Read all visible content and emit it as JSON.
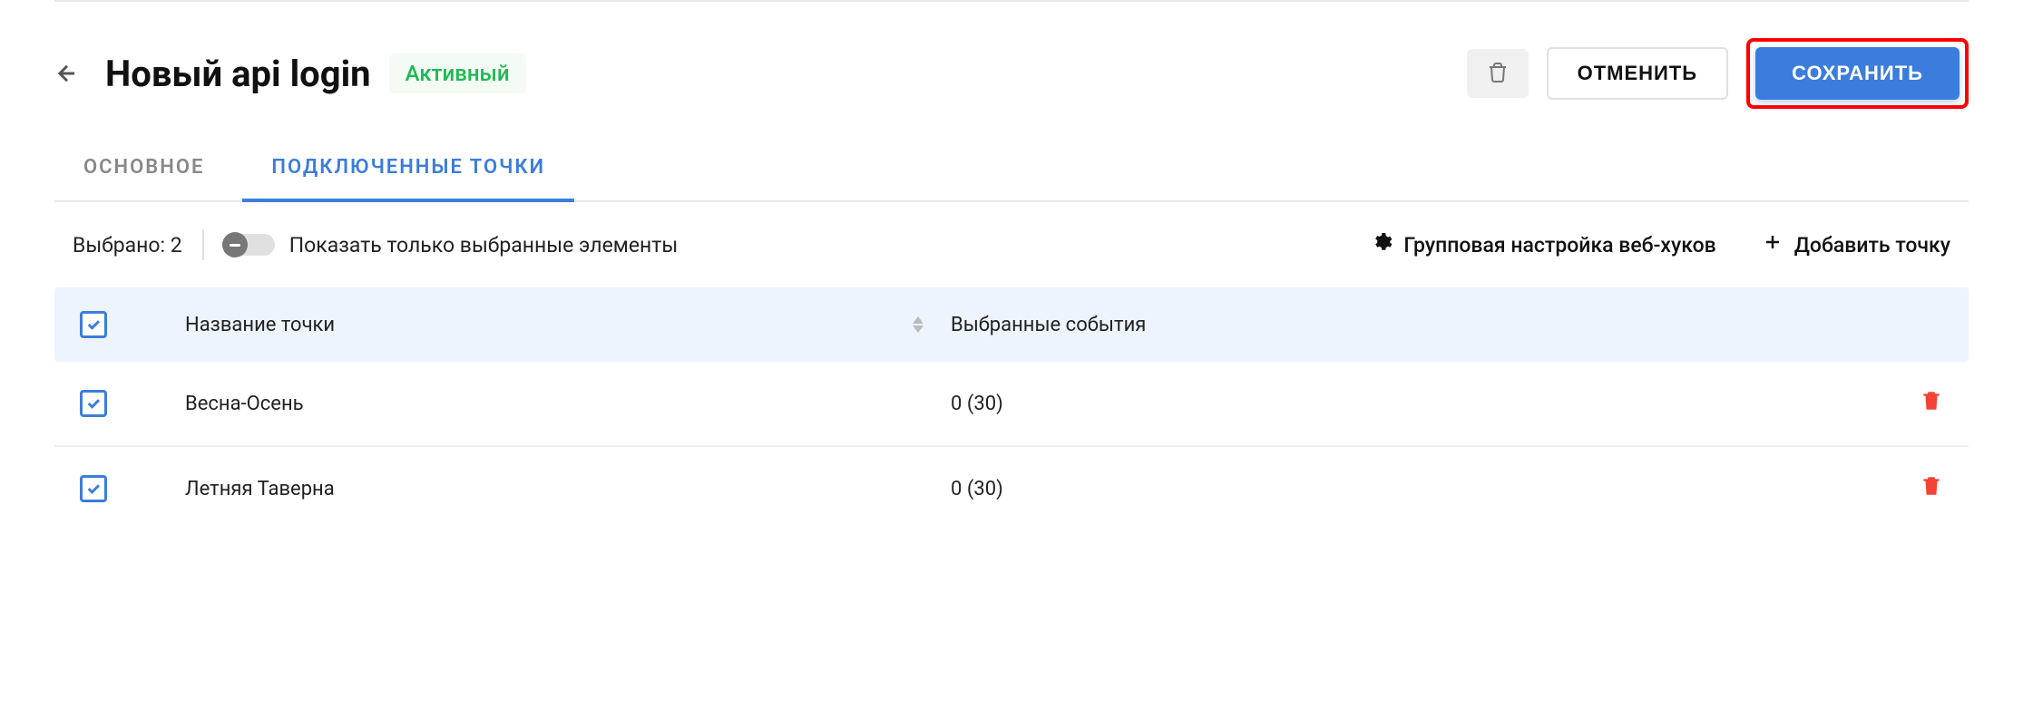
{
  "header": {
    "title": "Новый api login",
    "status": "Активный",
    "cancel_label": "ОТМЕНИТЬ",
    "save_label": "СОХРАНИТЬ"
  },
  "tabs": [
    {
      "label": "ОСНОВНОЕ",
      "active": false
    },
    {
      "label": "ПОДКЛЮЧЕННЫЕ ТОЧКИ",
      "active": true
    }
  ],
  "toolbar": {
    "selected_label": "Выбрано: 2",
    "toggle_label": "Показать только выбранные элементы",
    "group_webhooks_label": "Групповая настройка веб-хуков",
    "add_point_label": "Добавить точку"
  },
  "table": {
    "columns": {
      "name": "Название точки",
      "events": "Выбранные события"
    },
    "rows": [
      {
        "name": "Весна-Осень",
        "events": "0 (30)"
      },
      {
        "name": "Летняя Таверна",
        "events": "0 (30)"
      }
    ]
  }
}
